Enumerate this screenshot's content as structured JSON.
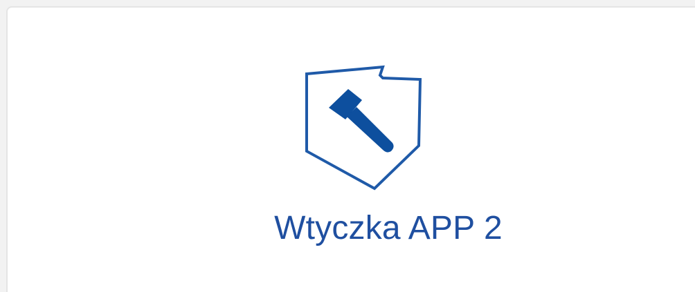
{
  "tile": {
    "title": "Wtyczka APP 2",
    "icon": "hammer-shield-icon"
  },
  "colors": {
    "brand": "#1f4fa0",
    "icon_stroke": "#1f5aa8",
    "tile_border": "#e4e4e4",
    "background": "#ffffff"
  }
}
